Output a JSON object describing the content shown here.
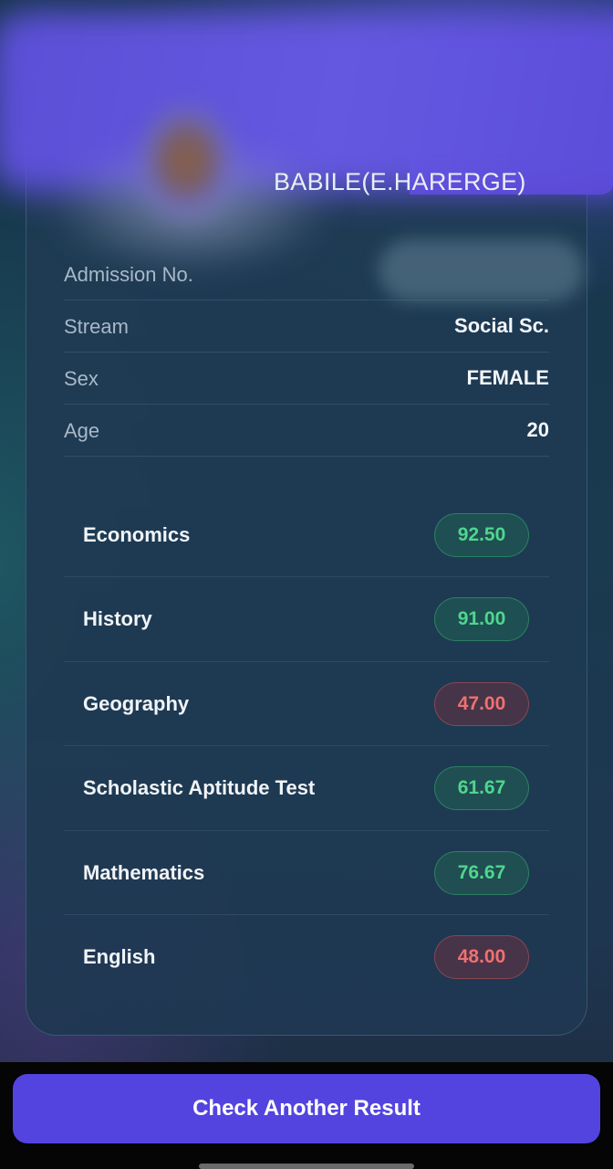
{
  "header": {
    "school_name": "BABILE(E.HARERGE)"
  },
  "student_info": [
    {
      "label": "Admission No.",
      "value": ""
    },
    {
      "label": "Stream",
      "value": "Social Sc."
    },
    {
      "label": "Sex",
      "value": "FEMALE"
    },
    {
      "label": "Age",
      "value": "20"
    }
  ],
  "subjects": [
    {
      "name": "Economics",
      "score": "92.50",
      "status": "pass"
    },
    {
      "name": "History",
      "score": "91.00",
      "status": "pass"
    },
    {
      "name": "Geography",
      "score": "47.00",
      "status": "fail"
    },
    {
      "name": "Scholastic Aptitude Test",
      "score": "61.67",
      "status": "pass"
    },
    {
      "name": "Mathematics",
      "score": "76.67",
      "status": "pass"
    },
    {
      "name": "English",
      "score": "48.00",
      "status": "fail"
    }
  ],
  "actions": {
    "check_another_label": "Check Another Result"
  },
  "colors": {
    "accent": "#5344e0",
    "pass": "#4fd68e",
    "fail": "#f07070"
  }
}
